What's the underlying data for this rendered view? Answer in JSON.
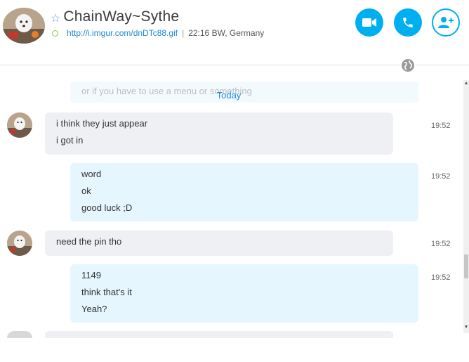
{
  "contact": {
    "name": "ChainWay~Sythe",
    "mood_link": "http://i.imgur.com/dnDTc88.gif",
    "separator": "|",
    "local_time_location": "22:16 BW, Germany"
  },
  "header_buttons": [
    {
      "name": "video-call",
      "icon": "video-camera-icon"
    },
    {
      "name": "audio-call",
      "icon": "phone-icon"
    },
    {
      "name": "add-people",
      "icon": "add-person-icon"
    }
  ],
  "ghost_text": "or if you have to use a menu or something",
  "day_label": "Today",
  "messages": [
    {
      "direction": "in",
      "lines": [
        "i think they just appear",
        "i got in"
      ],
      "time": "19:52"
    },
    {
      "direction": "out",
      "lines": [
        "word",
        "ok",
        "good luck ;D"
      ],
      "time": "19:52"
    },
    {
      "direction": "in",
      "lines": [
        "need the pin tho"
      ],
      "time": "19:52"
    },
    {
      "direction": "out",
      "lines": [
        "1149",
        "think that's it",
        "Yeah?"
      ],
      "time": "19:52"
    }
  ],
  "colors": {
    "accent": "#00aff0",
    "link": "#1e8ad6",
    "incoming_bg": "#eef0f3",
    "outgoing_bg": "#e5f6fe",
    "online": "#8cc63f"
  }
}
